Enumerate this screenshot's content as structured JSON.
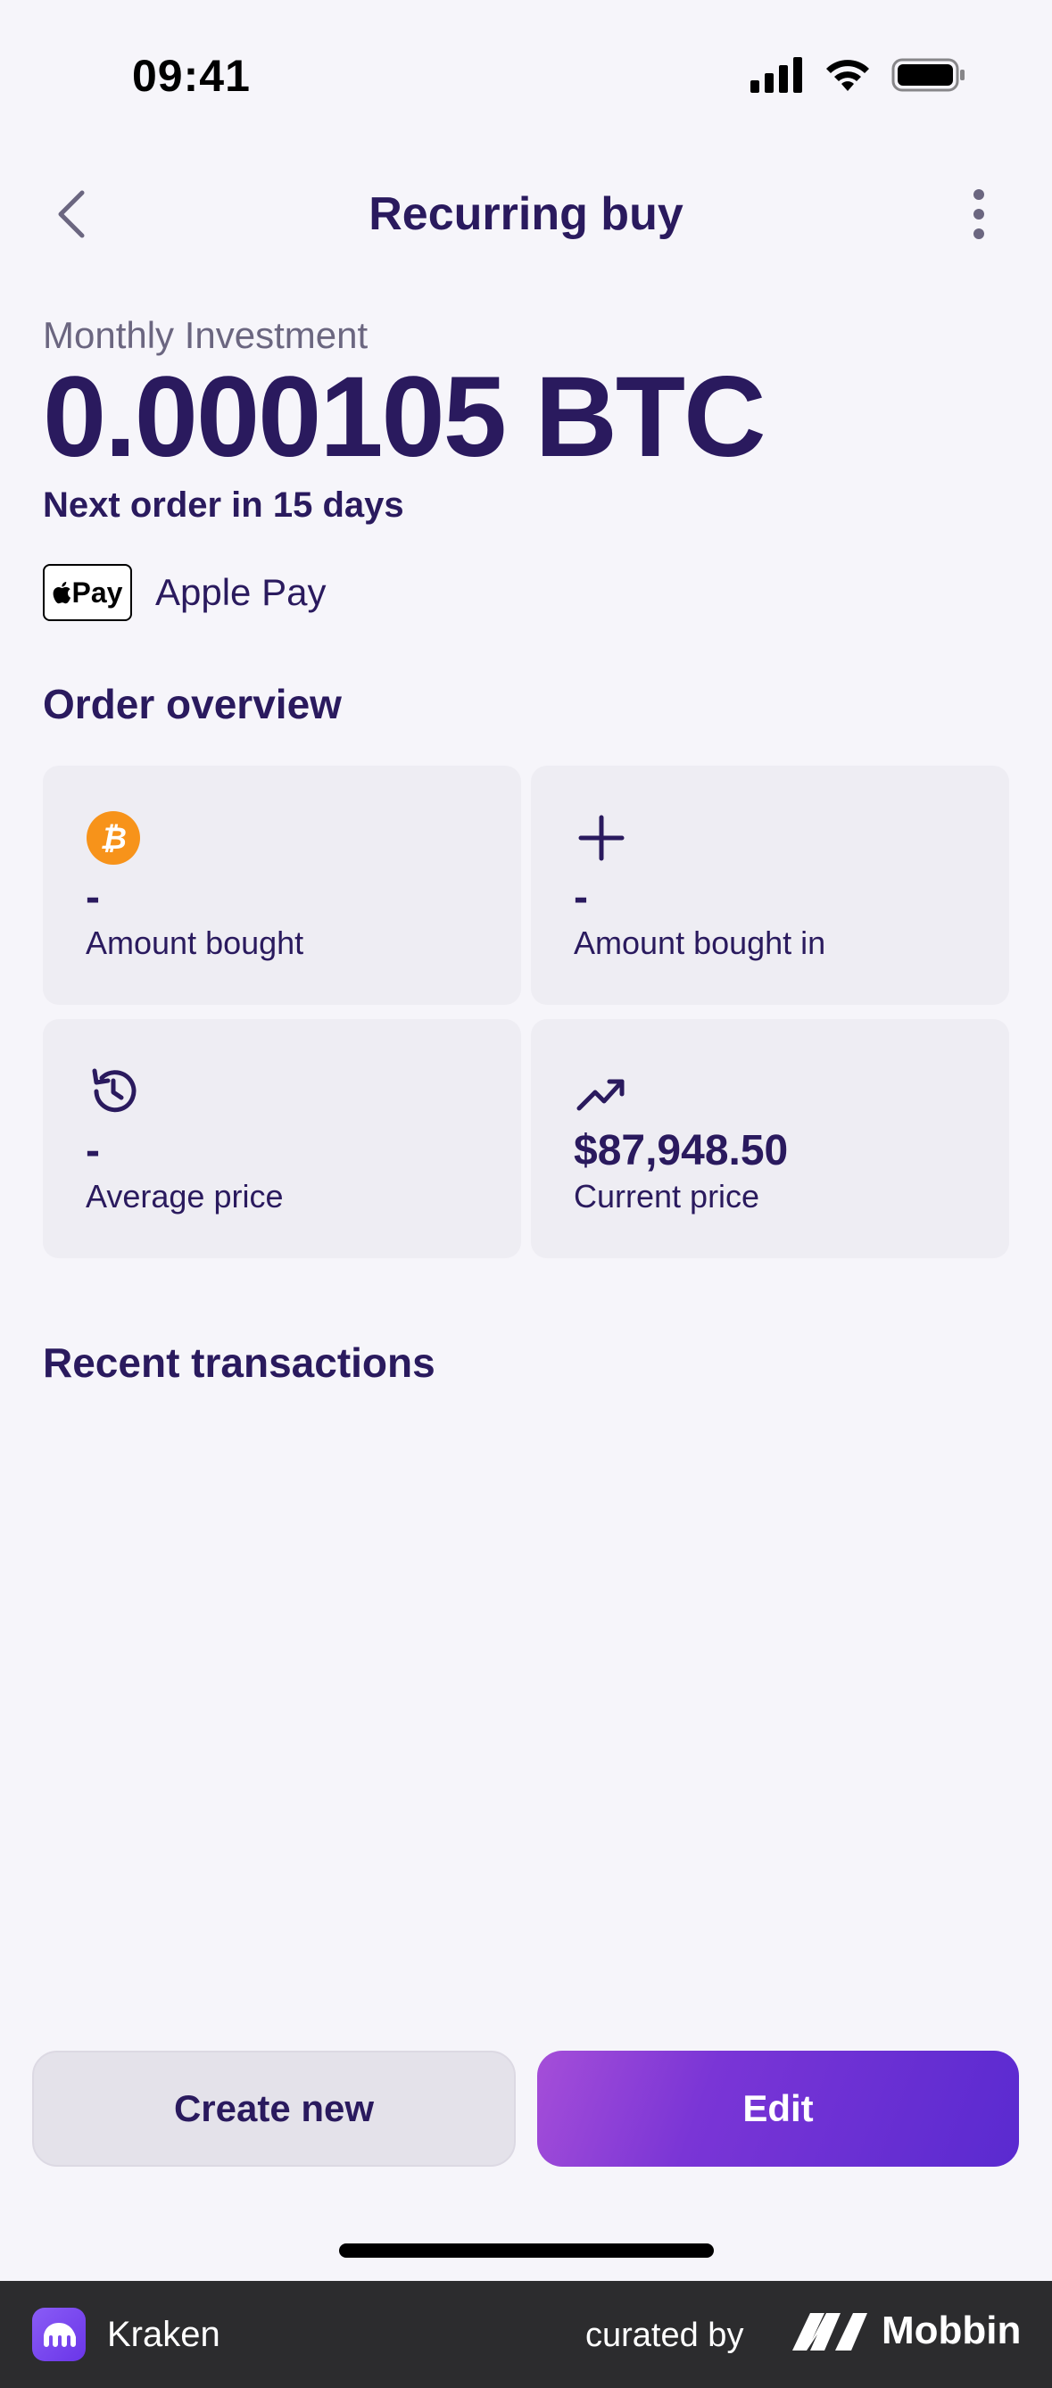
{
  "status_bar": {
    "time": "09:41"
  },
  "nav": {
    "title": "Recurring buy"
  },
  "summary": {
    "label": "Monthly Investment",
    "amount": "0.000105 BTC",
    "next_order": "Next order in 15 days"
  },
  "payment": {
    "badge": "Pay",
    "label": "Apple Pay"
  },
  "order_overview": {
    "title": "Order overview",
    "cards": [
      {
        "icon": "bitcoin-icon",
        "value": "-",
        "label": "Amount bought"
      },
      {
        "icon": "plus-icon",
        "value": "-",
        "label": "Amount bought in"
      },
      {
        "icon": "history-icon",
        "value": "-",
        "label": "Average price"
      },
      {
        "icon": "trending-up-icon",
        "value": "$87,948.50",
        "label": "Current price"
      }
    ]
  },
  "recent_transactions": {
    "title": "Recent transactions"
  },
  "actions": {
    "create_label": "Create new",
    "edit_label": "Edit"
  },
  "footer": {
    "app_name": "Kraken",
    "curated": "curated by",
    "brand": "Mobbin"
  },
  "colors": {
    "text": "#2a1a5e",
    "bitcoin": "#f7931a",
    "accent": "#5a2ad0"
  }
}
